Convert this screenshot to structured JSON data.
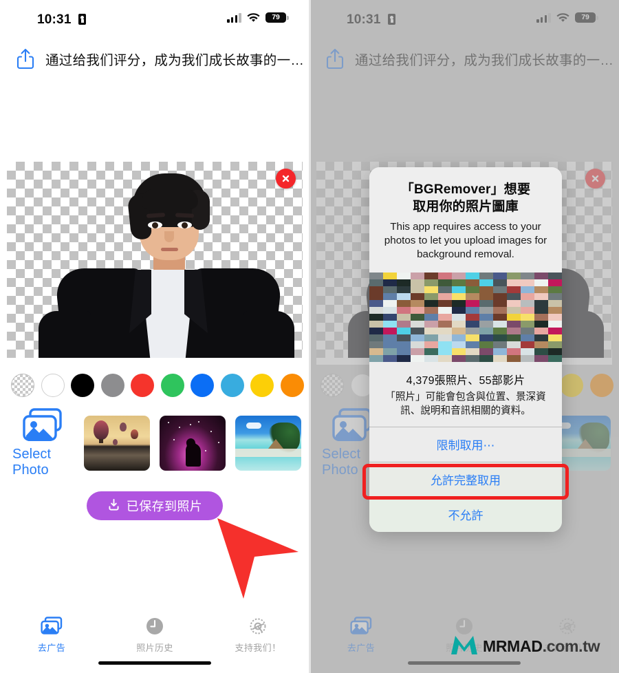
{
  "status_bar": {
    "time": "10:31",
    "lock_icon": "lock-portrait-icon",
    "signal_icon": "cellular-signal-icon",
    "wifi_icon": "wifi-icon",
    "battery_level": "79"
  },
  "banner": {
    "share_icon": "share-icon",
    "text": "通过给我们评分，成为我们成长故事的一…"
  },
  "canvas": {
    "close_button": "close-icon",
    "background": "transparent-checkerboard",
    "subject": "portrait-photo-cutout"
  },
  "swatches": {
    "colors": [
      {
        "name": "transparent",
        "hex": "transparent"
      },
      {
        "name": "white",
        "hex": "#ffffff"
      },
      {
        "name": "black",
        "hex": "#000000"
      },
      {
        "name": "gray",
        "hex": "#8d8d8f"
      },
      {
        "name": "red",
        "hex": "#f5342c"
      },
      {
        "name": "green",
        "hex": "#2fc45d"
      },
      {
        "name": "blue",
        "hex": "#0b6ef5"
      },
      {
        "name": "light-blue",
        "hex": "#38acdf"
      },
      {
        "name": "yellow",
        "hex": "#fccf07"
      },
      {
        "name": "orange",
        "hex": "#fa8c05"
      },
      {
        "name": "purple",
        "hex": "#ae4ed6"
      }
    ]
  },
  "photo_row": {
    "select_photo_label": "Select Photo",
    "select_photo_icon": "photo-stack-icon",
    "thumbnails": [
      {
        "name": "hot-air-balloons-thumbnail"
      },
      {
        "name": "nebula-horsehead-thumbnail"
      },
      {
        "name": "tropical-beach-thumbnail"
      }
    ]
  },
  "save_button": {
    "label": "已保存到照片",
    "icon": "download-icon",
    "color": "#b055e0"
  },
  "pointer": {
    "name": "red-arrow-cursor",
    "color": "#f5302c"
  },
  "tab_bar": {
    "tabs": [
      {
        "label": "去广告",
        "icon": "photos-icon",
        "active": true
      },
      {
        "label": "照片历史",
        "icon": "clock-icon",
        "active": false
      },
      {
        "label": "支持我们！",
        "icon": "gear-icon",
        "active": false
      }
    ]
  },
  "permission_dialog": {
    "title_line1": "「BGRemover」想要",
    "title_line2": "取用你的照片圖庫",
    "description": "This app requires access to your photos to let you upload images for background removal.",
    "media_preview": "pixelated-photo-grid",
    "count_text": "4,379張照片、55部影片",
    "detail_text": "「照片」可能會包含與位置、景深資訊、說明和音訊相關的資料。",
    "buttons": [
      {
        "label": "限制取用⋯",
        "highlighted": false
      },
      {
        "label": "允許完整取用",
        "highlighted": true
      },
      {
        "label": "不允許",
        "highlighted": false
      }
    ],
    "highlight_color": "#f02020"
  },
  "watermark": {
    "brand": "MRMAD",
    "domain": ".com.tw",
    "logo": "mrmad-logo-icon",
    "logo_color": "#0aa9a3"
  }
}
